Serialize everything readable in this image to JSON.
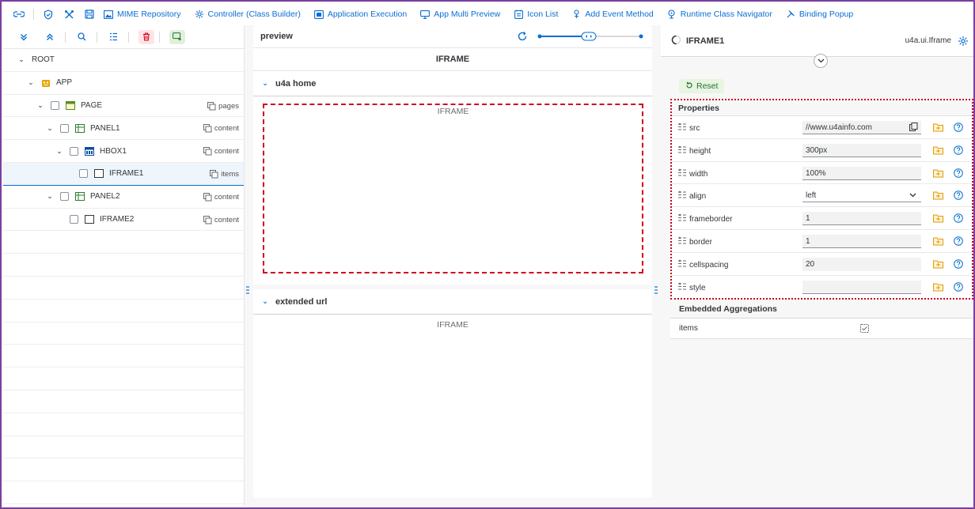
{
  "toolbar": {
    "buttons": [
      {
        "label": "MIME Repository",
        "icon": "image-icon"
      },
      {
        "label": "Controller (Class Builder)",
        "icon": "gear-icon"
      },
      {
        "label": "Application Execution",
        "icon": "run-icon"
      },
      {
        "label": "App Multi Preview",
        "icon": "multi-preview-icon"
      },
      {
        "label": "Icon List",
        "icon": "list-icon"
      },
      {
        "label": "Add Event Method",
        "icon": "event-icon"
      },
      {
        "label": "Runtime Class Navigator",
        "icon": "navigator-icon"
      },
      {
        "label": "Binding Popup",
        "icon": "binding-icon"
      }
    ]
  },
  "tree": {
    "rows": [
      {
        "label": "ROOT",
        "agg": ""
      },
      {
        "label": "APP",
        "agg": ""
      },
      {
        "label": "PAGE",
        "agg": "pages"
      },
      {
        "label": "PANEL1",
        "agg": "content"
      },
      {
        "label": "HBOX1",
        "agg": "content"
      },
      {
        "label": "IFRAME1",
        "agg": "items"
      },
      {
        "label": "PANEL2",
        "agg": "content"
      },
      {
        "label": "IFRAME2",
        "agg": "content"
      }
    ]
  },
  "preview": {
    "title": "preview",
    "iframe_title": "IFRAME",
    "section1": {
      "title": "u4a home",
      "content": "IFRAME"
    },
    "section2": {
      "title": "extended url",
      "content": "IFRAME"
    }
  },
  "properties": {
    "title": "IFRAME1",
    "class_name": "u4a.ui.Iframe",
    "reset_label": "Reset",
    "group_title": "Properties",
    "rows": [
      {
        "name": "src",
        "value": "//www.u4ainfo.com"
      },
      {
        "name": "height",
        "value": "300px"
      },
      {
        "name": "width",
        "value": "100%"
      },
      {
        "name": "align",
        "value": "left"
      },
      {
        "name": "frameborder",
        "value": "1"
      },
      {
        "name": "border",
        "value": "1"
      },
      {
        "name": "cellspacing",
        "value": "20"
      },
      {
        "name": "style",
        "value": ""
      }
    ],
    "embedded_title": "Embedded Aggregations",
    "embedded_rows": [
      {
        "name": "items"
      }
    ]
  },
  "colors": {
    "accent": "#0a6ed1",
    "highlight_border": "#d0021b",
    "frame_border": "#7b3fa0",
    "reset_bg": "#e8f5e0"
  }
}
